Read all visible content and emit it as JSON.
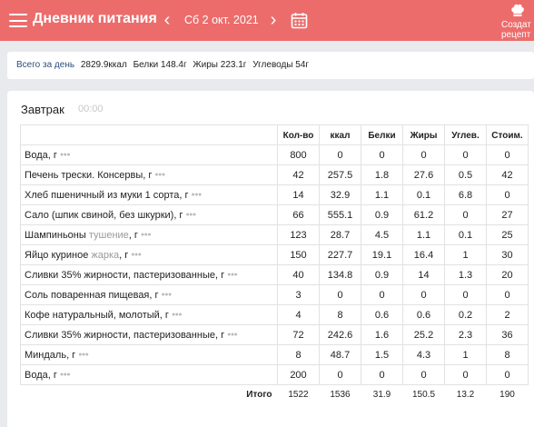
{
  "header": {
    "title": "Дневник питания",
    "date": "Сб 2 окт. 2021",
    "create_recipe": [
      "Создат",
      "рецепт"
    ],
    "accent_color": "#ec6c6c"
  },
  "summary": {
    "label": "Всего за день",
    "kcal": "2829.9ккал",
    "protein": "Белки 148.4г",
    "fat": "Жиры 223.1г",
    "carbs": "Углеводы 54г"
  },
  "meal": {
    "title": "Завтрак",
    "time": "00:00",
    "columns": [
      "Кол-во",
      "ккал",
      "Белки",
      "Жиры",
      "Углев.",
      "Стоим."
    ],
    "rows": [
      {
        "name": "Вода, г",
        "cooking": "",
        "suffix": "",
        "qty": "800",
        "kcal": "0",
        "protein": "0",
        "fat": "0",
        "carbs": "0",
        "cost": "0"
      },
      {
        "name": "Печень трески. Консервы, г",
        "cooking": "",
        "suffix": "",
        "qty": "42",
        "kcal": "257.5",
        "protein": "1.8",
        "fat": "27.6",
        "carbs": "0.5",
        "cost": "42"
      },
      {
        "name": "Хлеб пшеничный из муки 1 сорта, г",
        "cooking": "",
        "suffix": "",
        "qty": "14",
        "kcal": "32.9",
        "protein": "1.1",
        "fat": "0.1",
        "carbs": "6.8",
        "cost": "0"
      },
      {
        "name": "Сало (шпик свиной, без шкурки), г",
        "cooking": "",
        "suffix": "",
        "qty": "66",
        "kcal": "555.1",
        "protein": "0.9",
        "fat": "61.2",
        "carbs": "0",
        "cost": "27"
      },
      {
        "name": "Шампиньоны",
        "cooking": "тушение",
        "suffix": ", г",
        "qty": "123",
        "kcal": "28.7",
        "protein": "4.5",
        "fat": "1.1",
        "carbs": "0.1",
        "cost": "25"
      },
      {
        "name": "Яйцо куриное",
        "cooking": "жарка",
        "suffix": ", г",
        "qty": "150",
        "kcal": "227.7",
        "protein": "19.1",
        "fat": "16.4",
        "carbs": "1",
        "cost": "30"
      },
      {
        "name": "Сливки 35% жирности, пастеризованные, г",
        "cooking": "",
        "suffix": "",
        "qty": "40",
        "kcal": "134.8",
        "protein": "0.9",
        "fat": "14",
        "carbs": "1.3",
        "cost": "20"
      },
      {
        "name": "Соль поваренная пищевая, г",
        "cooking": "",
        "suffix": "",
        "qty": "3",
        "kcal": "0",
        "protein": "0",
        "fat": "0",
        "carbs": "0",
        "cost": "0"
      },
      {
        "name": "Кофе натуральный, молотый, г",
        "cooking": "",
        "suffix": "",
        "qty": "4",
        "kcal": "8",
        "protein": "0.6",
        "fat": "0.6",
        "carbs": "0.2",
        "cost": "2"
      },
      {
        "name": "Сливки 35% жирности, пастеризованные, г",
        "cooking": "",
        "suffix": "",
        "qty": "72",
        "kcal": "242.6",
        "protein": "1.6",
        "fat": "25.2",
        "carbs": "2.3",
        "cost": "36"
      },
      {
        "name": "Миндаль, г",
        "cooking": "",
        "suffix": "",
        "qty": "8",
        "kcal": "48.7",
        "protein": "1.5",
        "fat": "4.3",
        "carbs": "1",
        "cost": "8"
      },
      {
        "name": "Вода, г",
        "cooking": "",
        "suffix": "",
        "qty": "200",
        "kcal": "0",
        "protein": "0",
        "fat": "0",
        "carbs": "0",
        "cost": "0"
      }
    ],
    "total": {
      "label": "Итого",
      "qty": "1522",
      "kcal": "1536",
      "protein": "31.9",
      "fat": "150.5",
      "carbs": "13.2",
      "cost": "190"
    }
  }
}
